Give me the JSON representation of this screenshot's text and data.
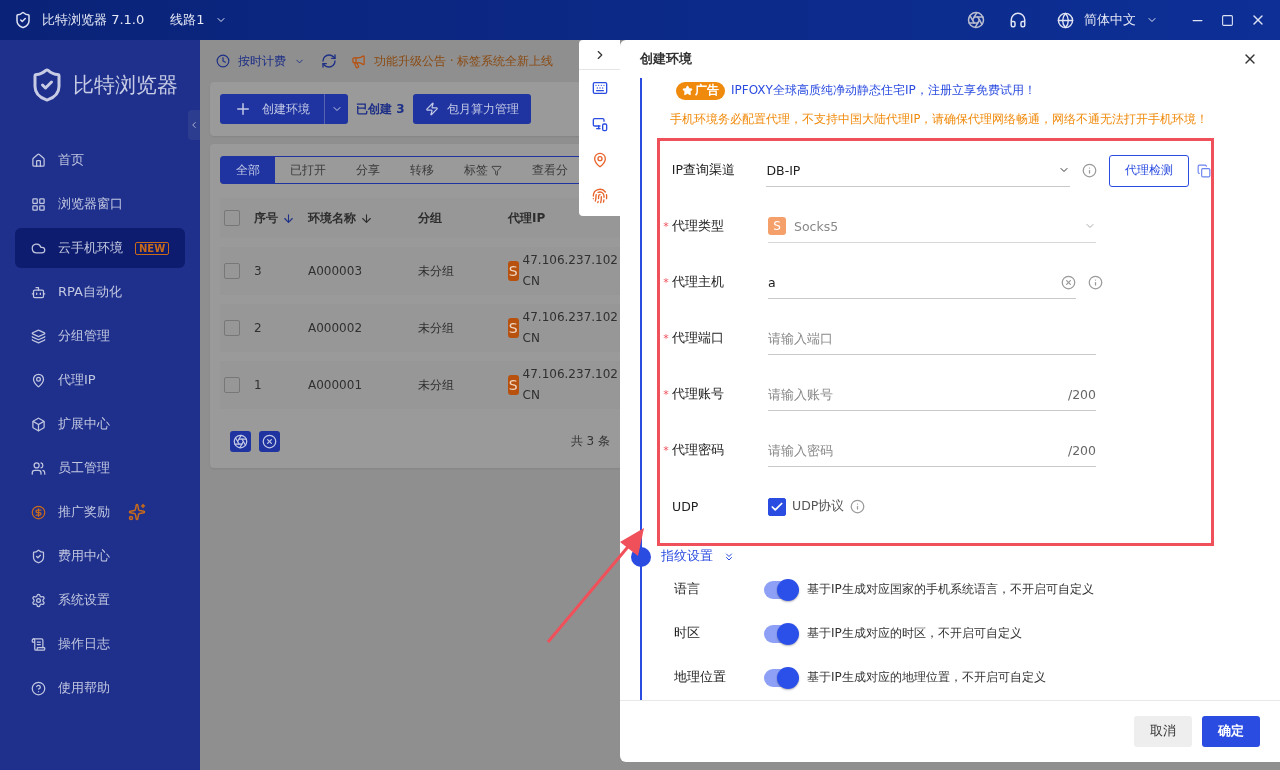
{
  "titlebar": {
    "app_title": "比特浏览器 7.1.0",
    "route": "线路1",
    "language": "简体中文"
  },
  "sidebar": {
    "brand": "比特浏览器",
    "items": [
      {
        "label": "首页",
        "selected": false
      },
      {
        "label": "浏览器窗口",
        "selected": false
      },
      {
        "label": "云手机环境",
        "selected": true,
        "badge": "NEW"
      },
      {
        "label": "RPA自动化",
        "selected": false
      },
      {
        "label": "分组管理",
        "selected": false
      },
      {
        "label": "代理IP",
        "selected": false
      },
      {
        "label": "扩展中心",
        "selected": false
      },
      {
        "label": "员工管理",
        "selected": false
      },
      {
        "label": "推广奖励",
        "selected": false,
        "sparkle": true
      },
      {
        "label": "费用中心",
        "selected": false
      },
      {
        "label": "系统设置",
        "selected": false
      },
      {
        "label": "操作日志",
        "selected": false
      },
      {
        "label": "使用帮助",
        "selected": false
      }
    ]
  },
  "toolbar": {
    "billing": "按时计费",
    "announcement": "功能升级公告 · 标签系统全新上线"
  },
  "actions": {
    "create": "创建环境",
    "created_count": "已创建 3",
    "monthly": "包月算力管理"
  },
  "filter_tabs": [
    {
      "label": "全部",
      "selected": true
    },
    {
      "label": "已打开",
      "selected": false
    },
    {
      "label": "分享",
      "selected": false
    },
    {
      "label": "转移",
      "selected": false
    },
    {
      "label": "标签",
      "selected": false,
      "filter": true
    },
    {
      "label": "查看分",
      "selected": false
    }
  ],
  "table": {
    "columns": [
      "序号",
      "环境名称",
      "分组",
      "代理IP"
    ],
    "rows": [
      {
        "checked": false,
        "index": "3",
        "name": "A000003",
        "group": "未分组",
        "proxy_badge": "S",
        "ip": "47.106.237.102",
        "country": "CN"
      },
      {
        "checked": false,
        "index": "2",
        "name": "A000002",
        "group": "未分组",
        "proxy_badge": "S",
        "ip": "47.106.237.102",
        "country": "CN"
      },
      {
        "checked": false,
        "index": "1",
        "name": "A000001",
        "group": "未分组",
        "proxy_badge": "S",
        "ip": "47.106.237.102",
        "country": "CN"
      }
    ],
    "total": "共 3 条",
    "select_all_checked": false
  },
  "dialog": {
    "title": "创建环境",
    "required_mark": "*",
    "ad_badge": "广告",
    "ad_text": "IPFOXY全球高质纯净动静态住宅IP，注册立享免费试用！",
    "warning": "手机环境务必配置代理，不支持中国大陆代理IP，请确保代理网络畅通，网络不通无法打开手机环境！",
    "fields": [
      {
        "kind": "select",
        "label": "IP查询渠道",
        "required": false,
        "value": "DB-IP",
        "info": true,
        "action": "代理检测"
      },
      {
        "kind": "select",
        "label": "代理类型",
        "required": true,
        "value": "Socks5",
        "badge": "S",
        "disabled": true
      },
      {
        "kind": "input",
        "label": "代理主机",
        "required": true,
        "value": "a",
        "clearable": true,
        "info": true
      },
      {
        "kind": "input",
        "label": "代理端口",
        "required": true,
        "placeholder": "请输入端口"
      },
      {
        "kind": "input",
        "label": "代理账号",
        "required": true,
        "placeholder": "请输入账号",
        "counter": "/200"
      },
      {
        "kind": "input",
        "label": "代理密码",
        "required": true,
        "placeholder": "请输入密码",
        "counter": "/200"
      },
      {
        "kind": "checkbox",
        "label": "UDP",
        "required": false,
        "option": "UDP协议",
        "checked": true,
        "info": true
      }
    ],
    "section": "指纹设置",
    "toggles": [
      {
        "label": "语言",
        "on": true,
        "hint": "基于IP生成对应国家的手机系统语言，不开启可自定义"
      },
      {
        "label": "时区",
        "on": true,
        "hint": "基于IP生成对应的时区，不开启可自定义"
      },
      {
        "label": "地理位置",
        "on": true,
        "hint": "基于IP生成对应的地理位置，不开启可自定义"
      }
    ],
    "cancel": "取消",
    "confirm": "确定"
  }
}
